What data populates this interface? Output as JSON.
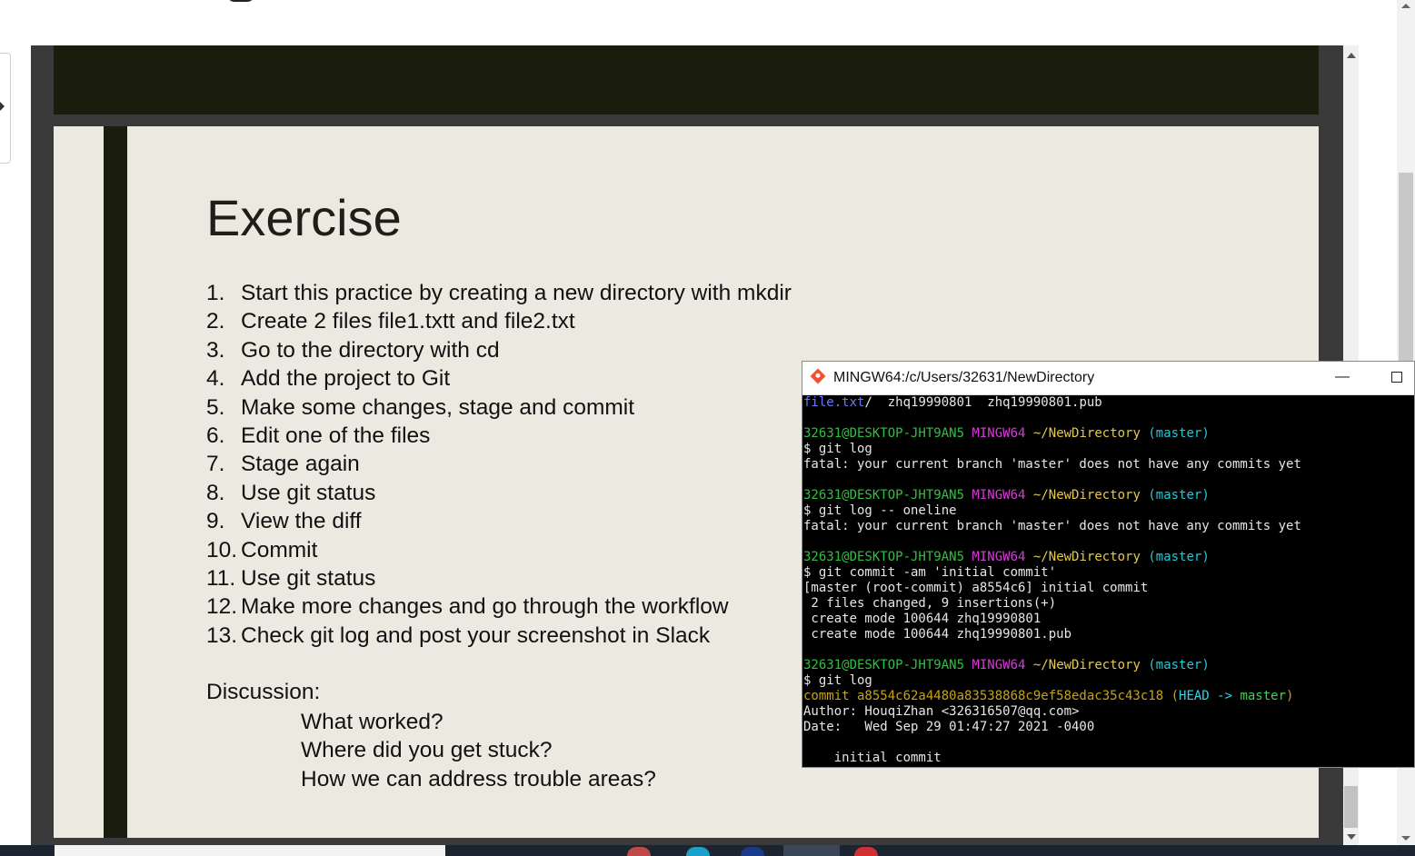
{
  "slide": {
    "title": "Exercise",
    "steps": [
      {
        "num": "1.",
        "text": "Start this practice by creating a new directory with mkdir"
      },
      {
        "num": "2.",
        "text": "Create 2  files file1.txtt and file2.txt"
      },
      {
        "num": "3.",
        "text": "Go to the directory with cd"
      },
      {
        "num": "4.",
        "text": "Add the project to Git"
      },
      {
        "num": "5.",
        "text": "Make some changes, stage and commit"
      },
      {
        "num": "6.",
        "text": "Edit one of the files"
      },
      {
        "num": "7.",
        "text": "Stage again"
      },
      {
        "num": "8.",
        "text": "Use git status"
      },
      {
        "num": "9.",
        "text": "View the diff"
      },
      {
        "num": "10.",
        "text": "Commit"
      },
      {
        "num": "11.",
        "text": "Use git status"
      },
      {
        "num": "12.",
        "text": "Make more changes and go through the workflow"
      },
      {
        "num": "13.",
        "text": "Check git log and post your screenshot in Slack"
      }
    ],
    "discussion_title": "Discussion:",
    "discussion_items": [
      "What worked?",
      "Where did you get stuck?",
      "How we can address trouble areas?"
    ]
  },
  "terminal": {
    "title": "MINGW64:/c/Users/32631/NewDirectory",
    "minimize": "—",
    "prompt": {
      "user": "32631@DESKTOP-JHT9AN5",
      "env": "MINGW64",
      "path": "~/NewDirectory",
      "branch": "(master)"
    },
    "lines": [
      [
        {
          "t": "file.txt",
          "c": "c-blue"
        },
        {
          "t": "/  zhq19990801  zhq19990801.pub"
        }
      ],
      [],
      "PROMPT",
      [
        {
          "t": "$ git log"
        }
      ],
      [
        {
          "t": "fatal: your current branch 'master' does not have any commits yet"
        }
      ],
      [],
      "PROMPT",
      [
        {
          "t": "$ git log -- oneline"
        }
      ],
      [
        {
          "t": "fatal: your current branch 'master' does not have any commits yet"
        }
      ],
      [],
      "PROMPT",
      [
        {
          "t": "$ git commit -am 'initial commit'"
        }
      ],
      [
        {
          "t": "[master (root-commit) a8554c6] initial commit"
        }
      ],
      [
        {
          "t": " 2 files changed, 9 insertions(+)"
        }
      ],
      [
        {
          "t": " create mode 100644 zhq19990801"
        }
      ],
      [
        {
          "t": " create mode 100644 zhq19990801.pub"
        }
      ],
      [],
      "PROMPT",
      [
        {
          "t": "$ git log"
        }
      ],
      [
        {
          "t": "commit a8554c62a4480a83538868c9ef58edac35c43c18 ",
          "c": "c-gold"
        },
        {
          "t": "(",
          "c": "c-gold"
        },
        {
          "t": "HEAD -> ",
          "c": "c-head"
        },
        {
          "t": "master",
          "c": "c-branch"
        },
        {
          "t": ")",
          "c": "c-gold"
        }
      ],
      [
        {
          "t": "Author: HouqiZhan <326316507@qq.com>"
        }
      ],
      [
        {
          "t": "Date:   Wed Sep 29 01:47:27 2021 -0400"
        }
      ],
      [],
      [
        {
          "t": "    initial commit"
        }
      ]
    ]
  },
  "colors": {
    "slide_background": "#ece9e0",
    "slide_accent": "#1a1c0e",
    "terminal_background": "#000000",
    "prompt_user": "#2ec13e",
    "prompt_env": "#d73bd7",
    "prompt_path": "#e6c84a",
    "prompt_branch": "#2ac6d6"
  },
  "icons": [
    "git-icon",
    "minimize-icon",
    "maximize-icon",
    "scroll-up-icon",
    "scroll-down-icon",
    "sidebar-toggle-icon"
  ]
}
